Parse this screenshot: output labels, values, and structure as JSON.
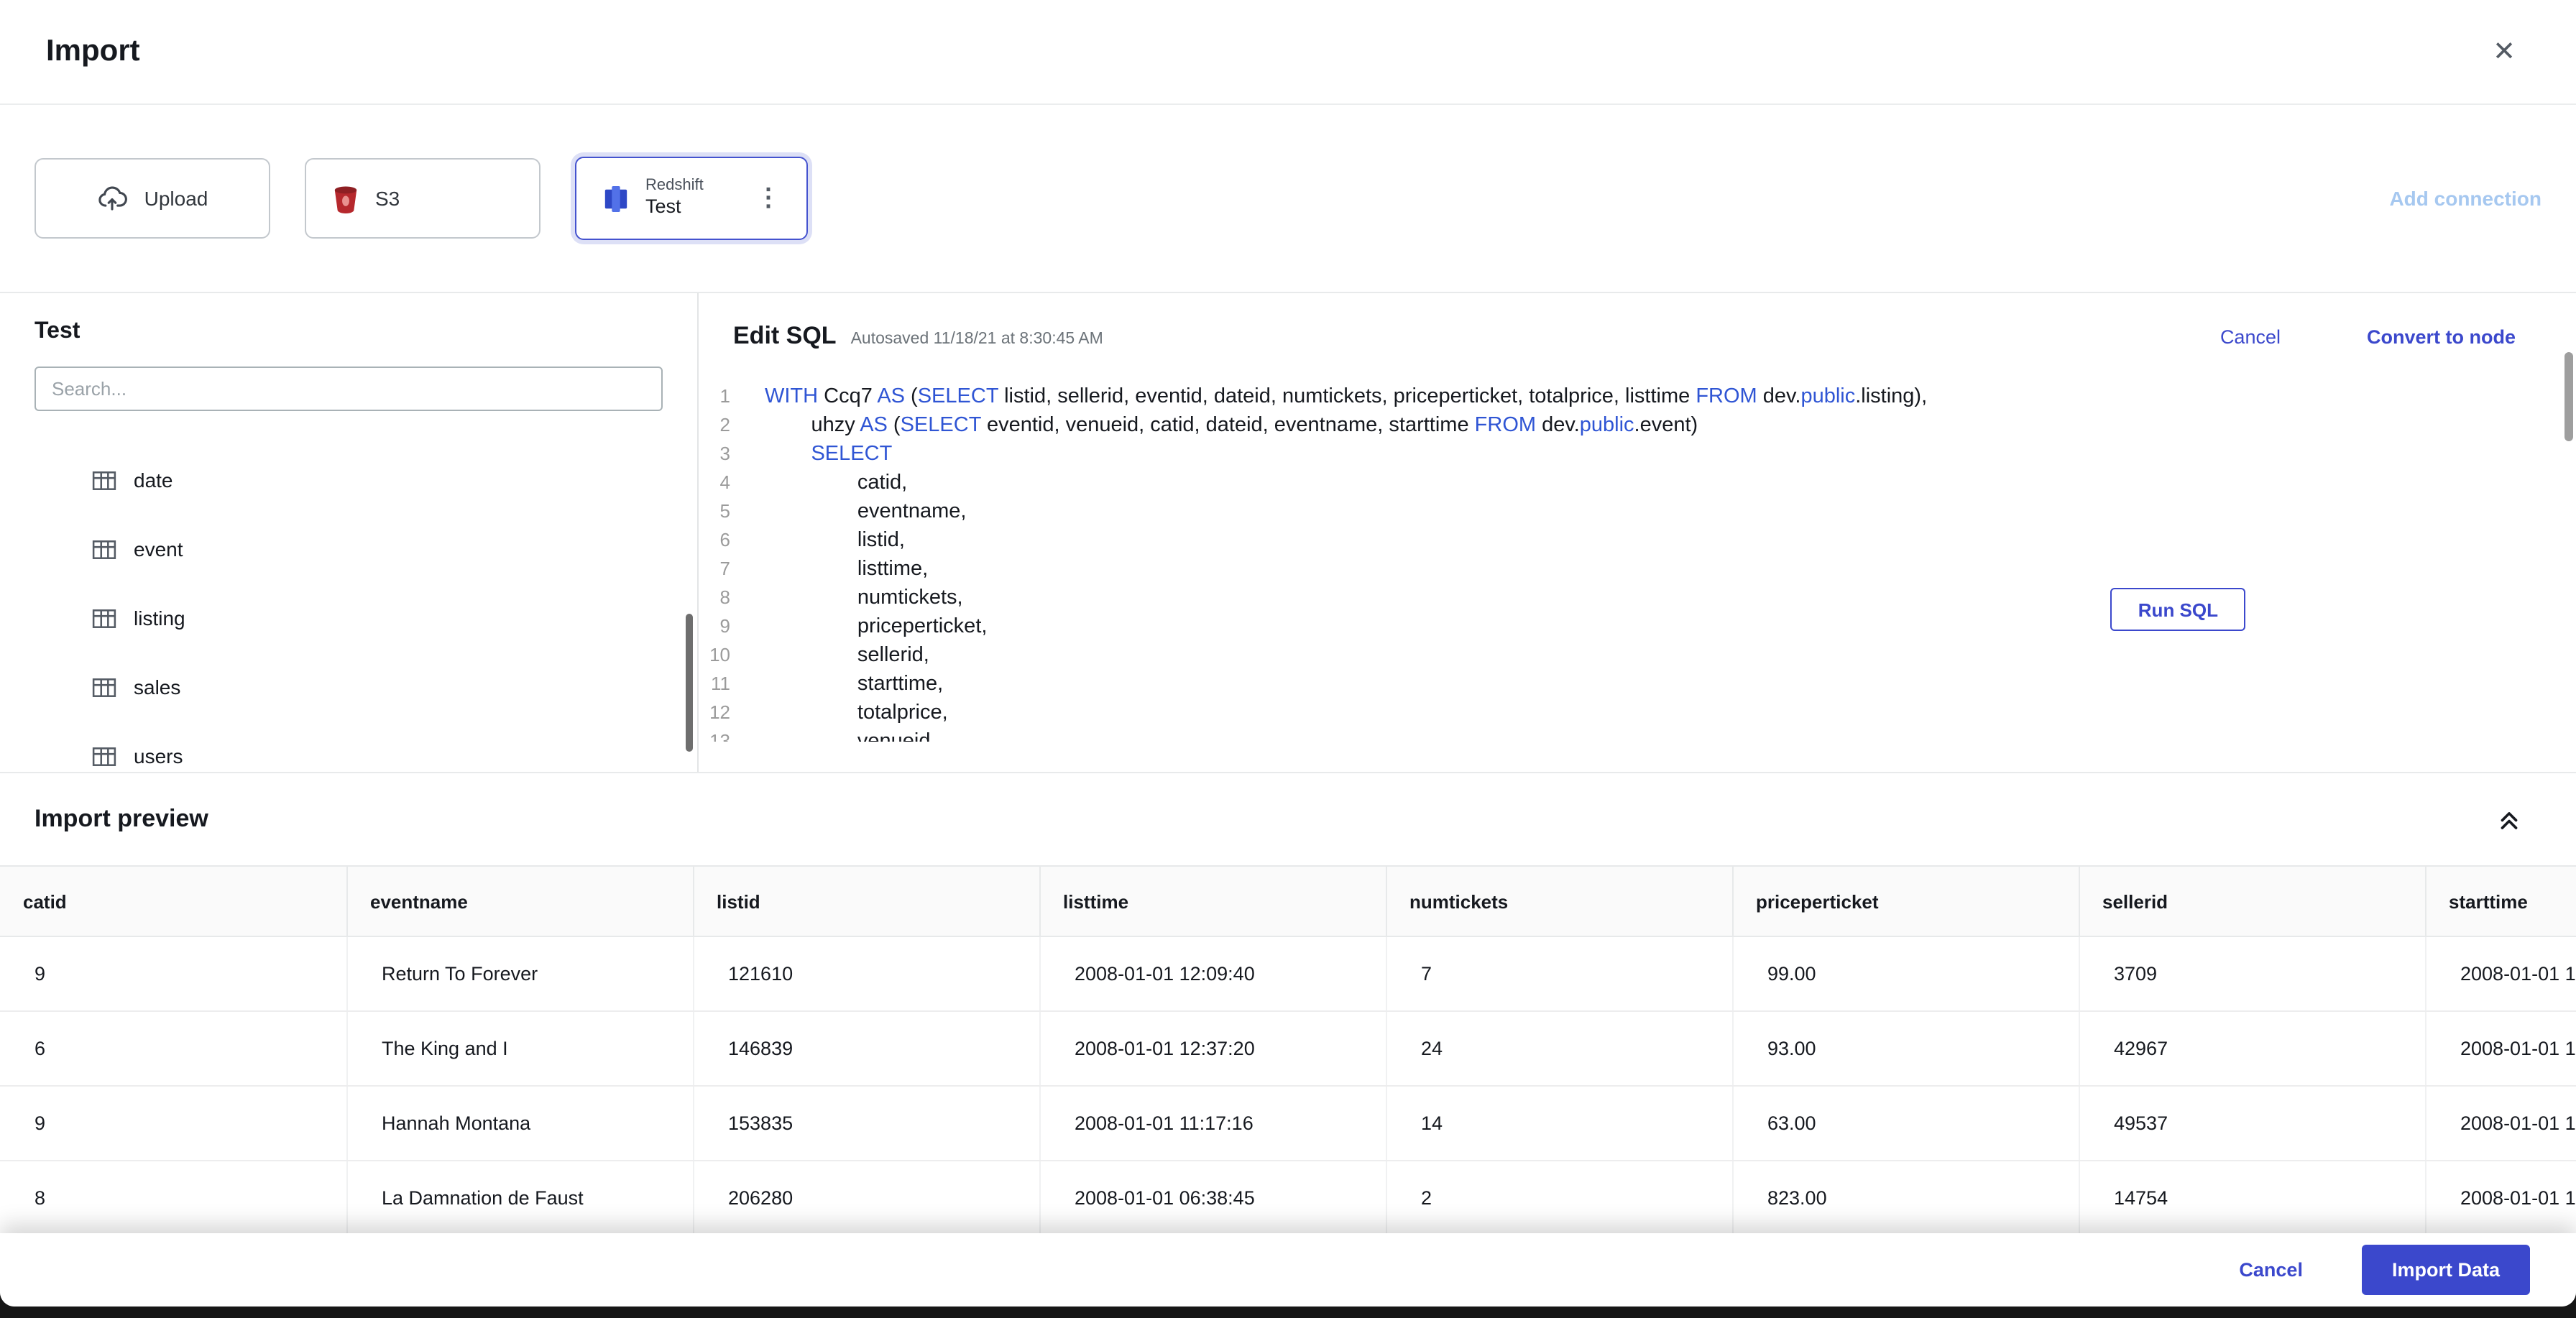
{
  "header": {
    "title": "Import"
  },
  "icons": {
    "close": "✕",
    "kebab": "⋮"
  },
  "connections": {
    "tiles": [
      {
        "label": "Upload"
      },
      {
        "label": "S3"
      },
      {
        "type_label": "Redshift",
        "name": "Test",
        "selected": true
      }
    ],
    "add_connection_label": "Add connection"
  },
  "sidebar": {
    "title": "Test",
    "search_placeholder": "Search...",
    "tables": [
      "date",
      "event",
      "listing",
      "sales",
      "users"
    ]
  },
  "editor": {
    "title": "Edit SQL",
    "autosave_text": "Autosaved 11/18/21 at 8:30:45 AM",
    "cancel_label": "Cancel",
    "convert_label": "Convert to node",
    "run_sql_label": "Run SQL",
    "lines": [
      [
        [
          "k",
          "WITH"
        ],
        [
          "p",
          " Ccq7 "
        ],
        [
          "k",
          "AS"
        ],
        [
          "p",
          " ("
        ],
        [
          "k",
          "SELECT"
        ],
        [
          "p",
          " listid, sellerid, eventid, dateid, numtickets, priceperticket, totalprice, listtime "
        ],
        [
          "k",
          "FROM"
        ],
        [
          "p",
          " dev."
        ],
        [
          "k",
          "public"
        ],
        [
          "p",
          ".listing),"
        ]
      ],
      [
        [
          "p",
          "        uhzy "
        ],
        [
          "k",
          "AS"
        ],
        [
          "p",
          " ("
        ],
        [
          "k",
          "SELECT"
        ],
        [
          "p",
          " eventid, venueid, catid, dateid, eventname, starttime "
        ],
        [
          "k",
          "FROM"
        ],
        [
          "p",
          " dev."
        ],
        [
          "k",
          "public"
        ],
        [
          "p",
          ".event)"
        ]
      ],
      [
        [
          "p",
          "        "
        ],
        [
          "k",
          "SELECT"
        ]
      ],
      [
        [
          "p",
          "                catid,"
        ]
      ],
      [
        [
          "p",
          "                eventname,"
        ]
      ],
      [
        [
          "p",
          "                listid,"
        ]
      ],
      [
        [
          "p",
          "                listtime,"
        ]
      ],
      [
        [
          "p",
          "                numtickets,"
        ]
      ],
      [
        [
          "p",
          "                priceperticket,"
        ]
      ],
      [
        [
          "p",
          "                sellerid,"
        ]
      ],
      [
        [
          "p",
          "                starttime,"
        ]
      ],
      [
        [
          "p",
          "                totalprice,"
        ]
      ],
      [
        [
          "p",
          "                venueid,"
        ]
      ]
    ]
  },
  "preview": {
    "title": "Import preview",
    "columns": [
      "catid",
      "eventname",
      "listid",
      "listtime",
      "numtickets",
      "priceperticket",
      "sellerid",
      "starttime"
    ],
    "rows": [
      [
        "9",
        "Return To Forever",
        "121610",
        "2008-01-01 12:09:40",
        "7",
        "99.00",
        "3709",
        "2008-01-01 1"
      ],
      [
        "6",
        "The King and I",
        "146839",
        "2008-01-01 12:37:20",
        "24",
        "93.00",
        "42967",
        "2008-01-01 1"
      ],
      [
        "9",
        "Hannah Montana",
        "153835",
        "2008-01-01 11:17:16",
        "14",
        "63.00",
        "49537",
        "2008-01-01 1"
      ],
      [
        "8",
        "La Damnation de Faust",
        "206280",
        "2008-01-01 06:38:45",
        "2",
        "823.00",
        "14754",
        "2008-01-01 1"
      ]
    ]
  },
  "footer": {
    "cancel_label": "Cancel",
    "import_label": "Import Data"
  },
  "colors": {
    "primary": "#3b48cc",
    "sql_keyword": "#2f55d4",
    "add_connection_disabled": "#a6c8f0",
    "s3_icon": "#b6282d",
    "redshift_icon": "#3b55e6"
  }
}
